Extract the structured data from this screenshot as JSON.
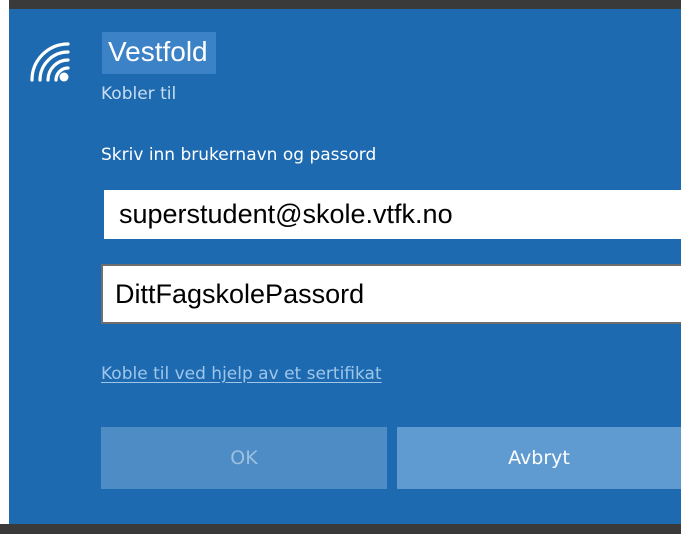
{
  "network": {
    "name": "Vestfold",
    "status": "Kobler til",
    "icon": "wifi-icon"
  },
  "prompt": {
    "label": "Skriv inn brukernavn og passord"
  },
  "fields": {
    "username_value": "superstudent@skole.vtfk.no",
    "password_value": "DittFagskolePassord"
  },
  "links": {
    "certificate": "Koble til ved hjelp av et sertifikat"
  },
  "buttons": {
    "ok_label": "OK",
    "cancel_label": "Avbryt"
  },
  "colors": {
    "panel_bg": "#1e6ab0",
    "selection_highlight": "#3b82c6",
    "link": "#9ec6ea",
    "ok_button_disabled": "#4d8cc4",
    "cancel_button": "#5f9bd0"
  }
}
